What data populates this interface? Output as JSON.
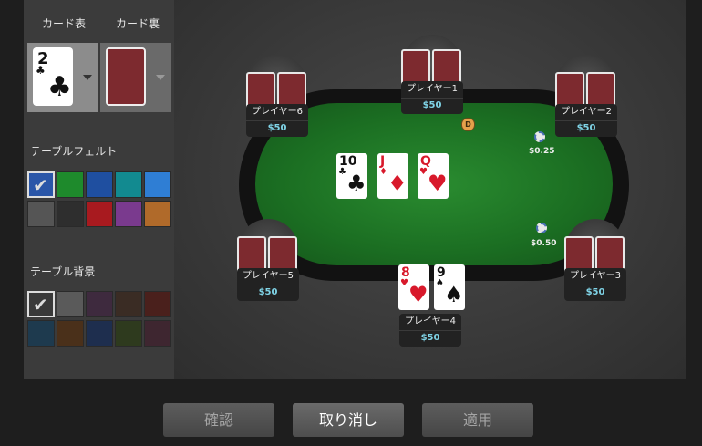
{
  "sidebar": {
    "card_front_label": "カード表",
    "card_back_label": "カード裏",
    "card_front_preview": {
      "rank": "2",
      "suit": "♣",
      "suit_icon": "club-icon"
    },
    "felt_label": "テーブルフェルト",
    "background_label": "テーブル背景",
    "felt_colors": [
      "#2a56a8",
      "#1e8a2c",
      "#1f4fa0",
      "#128a90",
      "#2f7ed4",
      "#555555",
      "#2e2e2e",
      "#a81a1f",
      "#7a3a8e",
      "#b06a2a"
    ],
    "background_colors": [
      "#3a3a3a",
      "#5a5a5a",
      "#3e2a3e",
      "#3a2c24",
      "#4a201c",
      "#1e3a4e",
      "#4a301a",
      "#1e2e4e",
      "#2e3a1e",
      "#3e2630"
    ],
    "felt_selected_index": 0,
    "background_selected_index": 0
  },
  "table": {
    "community_cards": [
      {
        "rank": "10",
        "suit": "♣",
        "color": "black"
      },
      {
        "rank": "J",
        "suit": "♦",
        "color": "red"
      },
      {
        "rank": "Q",
        "suit": "♥",
        "color": "red"
      }
    ],
    "hero_cards": [
      {
        "rank": "8",
        "suit": "♥",
        "color": "red"
      },
      {
        "rank": "9",
        "suit": "♠",
        "color": "black"
      }
    ],
    "players": [
      {
        "name": "プレイヤー1",
        "stack": "$50"
      },
      {
        "name": "プレイヤー2",
        "stack": "$50"
      },
      {
        "name": "プレイヤー3",
        "stack": "$50"
      },
      {
        "name": "プレイヤー4",
        "stack": "$50"
      },
      {
        "name": "プレイヤー5",
        "stack": "$50"
      },
      {
        "name": "プレイヤー6",
        "stack": "$50"
      }
    ],
    "dealer_button": "D",
    "bets": [
      "$0.25",
      "$0.50"
    ]
  },
  "buttons": {
    "confirm": "確認",
    "cancel": "取り消し",
    "apply": "適用"
  },
  "colors": {
    "felt": "#1f7a25",
    "card_back": "#7d2a2f",
    "stack_text": "#7fd3e6"
  }
}
